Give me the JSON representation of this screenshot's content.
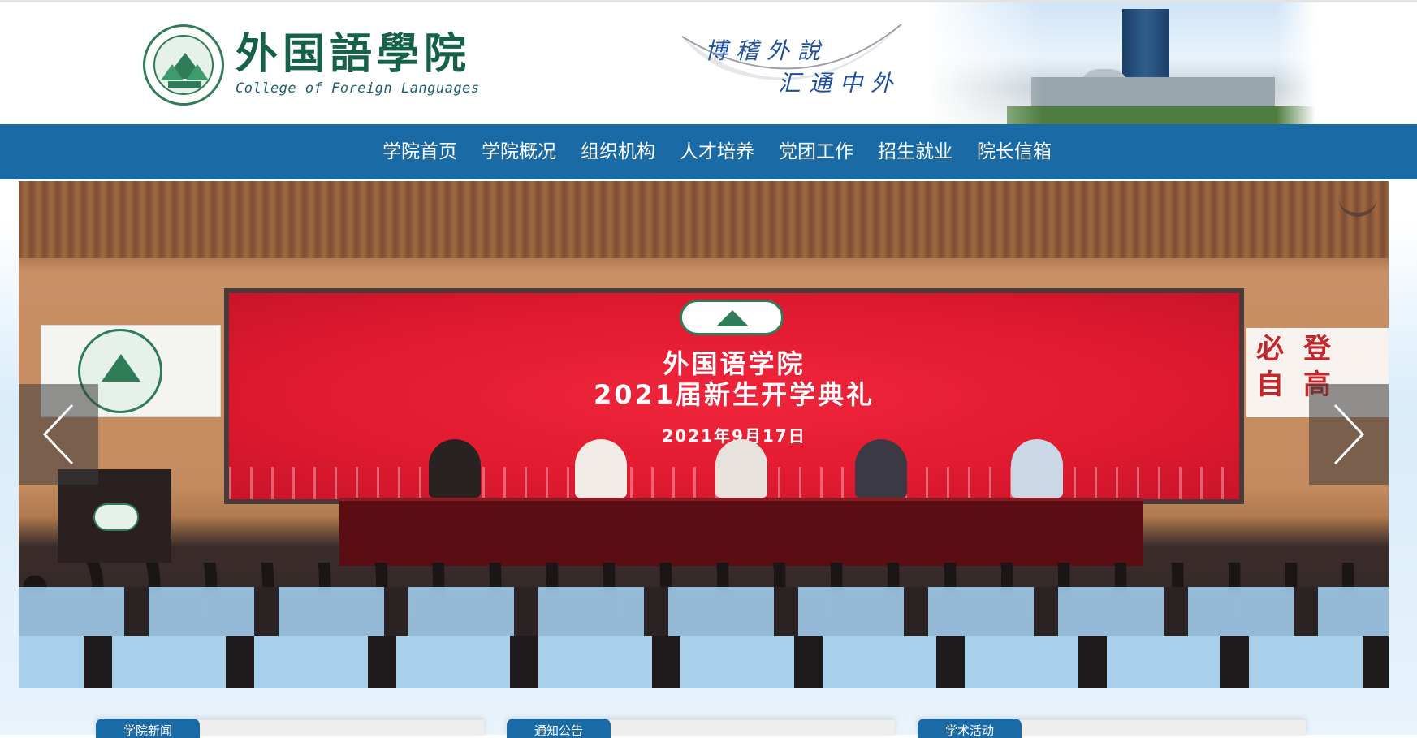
{
  "header": {
    "name_cn": "外国語學院",
    "name_en": "College of Foreign Languages",
    "motto_line1": "博稽外說",
    "motto_line2": "汇通中外"
  },
  "nav": {
    "items": [
      "学院首页",
      "学院概况",
      "组织机构",
      "人才培养",
      "党团工作",
      "招生就业",
      "院长信箱"
    ]
  },
  "banner": {
    "screen_title": "外国语学院",
    "screen_subtitle": "2021届新生开学典礼",
    "screen_date": "2021年9月17日",
    "right_sign": "必登自高",
    "prev_icon": "chevron-left-icon",
    "next_icon": "chevron-right-icon"
  },
  "sections": [
    {
      "label": "学院新闻"
    },
    {
      "label": "通知公告"
    },
    {
      "label": "学术活动"
    }
  ],
  "colors": {
    "nav_bg": "#1a6aa6",
    "brand_green": "#15614a",
    "screen_red": "#e01a30"
  }
}
